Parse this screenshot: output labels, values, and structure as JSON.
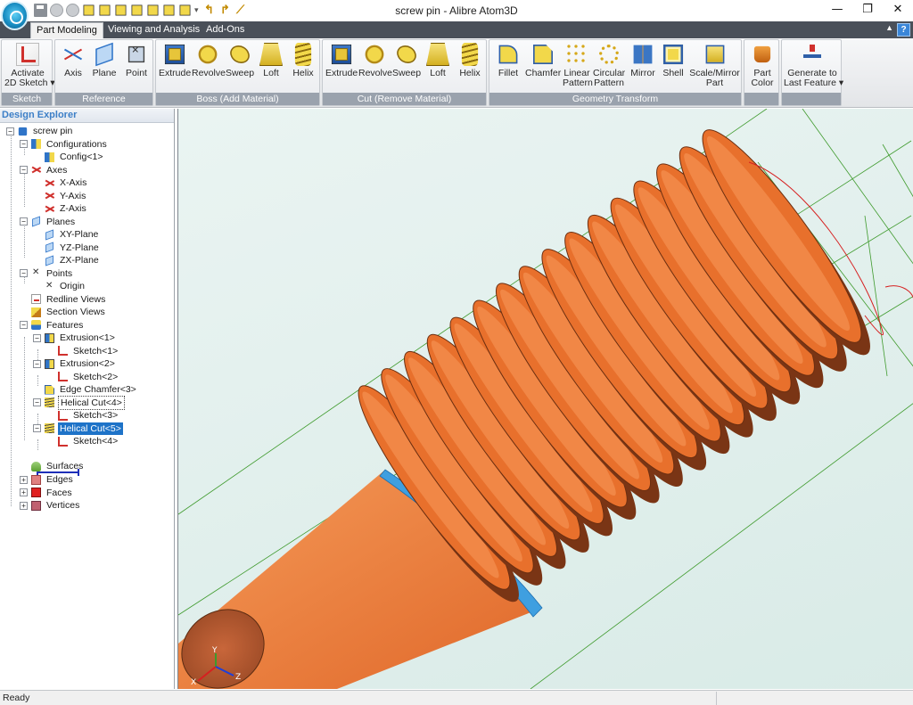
{
  "window": {
    "title": "screw pin - Alibre Atom3D",
    "controls": {
      "minimize": "—",
      "restore": "❐",
      "close": "✕"
    }
  },
  "quick_access": {
    "icons": [
      "save-icon",
      "undo-history-icon",
      "redo-history-icon",
      "view-cube-icon",
      "view-cube-icon",
      "view-cube-icon",
      "view-cube-icon",
      "view-cube-icon",
      "view-cube-icon",
      "view-cube-icon",
      "dropdown-icon",
      "undo-arrow-icon",
      "redo-arrow-icon",
      "sketch-line-icon"
    ]
  },
  "tabs": [
    {
      "label": "Part Modeling",
      "active": true
    },
    {
      "label": "Viewing and Analysis",
      "active": false
    },
    {
      "label": "Add-Ons",
      "active": false
    }
  ],
  "ribbon": {
    "help": "?",
    "groups": {
      "sketch": {
        "label": "Sketch",
        "buttons": [
          {
            "line1": "Activate",
            "line2": "2D Sketch ▾",
            "icon": "sketch-icon"
          }
        ]
      },
      "reference": {
        "label": "Reference",
        "buttons": [
          {
            "line1": "Axis",
            "icon": "axis-icon"
          },
          {
            "line1": "Plane",
            "icon": "plane-icon"
          },
          {
            "line1": "Point",
            "icon": "point-icon"
          }
        ]
      },
      "boss": {
        "label": "Boss (Add Material)",
        "buttons": [
          {
            "line1": "Extrude",
            "icon": "extrude-icon"
          },
          {
            "line1": "Revolve",
            "icon": "revolve-icon"
          },
          {
            "line1": "Sweep",
            "icon": "sweep-icon"
          },
          {
            "line1": "Loft",
            "icon": "loft-icon"
          },
          {
            "line1": "Helix",
            "icon": "helix-icon"
          }
        ]
      },
      "cut": {
        "label": "Cut (Remove Material)",
        "buttons": [
          {
            "line1": "Extrude",
            "icon": "extrude-cut-icon"
          },
          {
            "line1": "Revolve",
            "icon": "revolve-cut-icon"
          },
          {
            "line1": "Sweep",
            "icon": "sweep-cut-icon"
          },
          {
            "line1": "Loft",
            "icon": "loft-cut-icon"
          },
          {
            "line1": "Helix",
            "icon": "helix-cut-icon"
          }
        ]
      },
      "transform": {
        "label": "Geometry Transform",
        "buttons": [
          {
            "line1": "Fillet",
            "icon": "fillet-icon"
          },
          {
            "line1": "Chamfer",
            "icon": "chamfer-icon"
          },
          {
            "line1": "Linear",
            "line2": "Pattern",
            "icon": "linear-pattern-icon"
          },
          {
            "line1": "Circular",
            "line2": "Pattern",
            "icon": "circular-pattern-icon"
          },
          {
            "line1": "Mirror",
            "icon": "mirror-icon"
          },
          {
            "line1": "Shell",
            "icon": "shell-icon"
          },
          {
            "line1": "Scale/Mirror",
            "line2": "Part",
            "icon": "scale-mirror-icon"
          }
        ]
      },
      "color": {
        "buttons": [
          {
            "line1": "Part",
            "line2": "Color",
            "icon": "part-color-icon"
          }
        ]
      },
      "generate": {
        "buttons": [
          {
            "line1": "Generate to",
            "line2": "Last Feature ▾",
            "icon": "generate-icon"
          }
        ]
      }
    }
  },
  "explorer": {
    "title": "Design Explorer",
    "tree": [
      {
        "label": "screw pin",
        "icon": "part-icon",
        "expander": "−"
      },
      {
        "label": "Configurations",
        "icon": "configurations-icon",
        "expander": "−"
      },
      {
        "label": "Config<1>",
        "icon": "config-icon"
      },
      {
        "label": "Axes",
        "icon": "axes-icon",
        "expander": "−"
      },
      {
        "label": "X-Axis",
        "icon": "axis-icon"
      },
      {
        "label": "Y-Axis",
        "icon": "axis-icon"
      },
      {
        "label": "Z-Axis",
        "icon": "axis-icon"
      },
      {
        "label": "Planes",
        "icon": "planes-icon",
        "expander": "−"
      },
      {
        "label": "XY-Plane",
        "icon": "plane-icon"
      },
      {
        "label": "YZ-Plane",
        "icon": "plane-icon"
      },
      {
        "label": "ZX-Plane",
        "icon": "plane-icon"
      },
      {
        "label": "Points",
        "icon": "points-icon",
        "expander": "−"
      },
      {
        "label": "Origin",
        "icon": "point-icon"
      },
      {
        "label": "Redline Views",
        "icon": "redline-icon"
      },
      {
        "label": "Section Views",
        "icon": "section-icon"
      },
      {
        "label": "Features",
        "icon": "features-icon",
        "expander": "−"
      },
      {
        "label": "Extrusion<1>",
        "icon": "extrusion-icon",
        "expander": "−"
      },
      {
        "label": "Sketch<1>",
        "icon": "sketch-icon"
      },
      {
        "label": "Extrusion<2>",
        "icon": "extrusion-icon",
        "expander": "−"
      },
      {
        "label": "Sketch<2>",
        "icon": "sketch-icon"
      },
      {
        "label": "Edge Chamfer<3>",
        "icon": "chamfer-icon"
      },
      {
        "label": "Helical Cut<4>",
        "icon": "helical-cut-icon",
        "expander": "−"
      },
      {
        "label": "Sketch<3>",
        "icon": "sketch-icon"
      },
      {
        "label": "Helical Cut<5>",
        "icon": "helical-cut-icon",
        "expander": "−"
      },
      {
        "label": "Sketch<4>",
        "icon": "sketch-icon"
      },
      {
        "label": "Surfaces",
        "icon": "surfaces-icon"
      },
      {
        "label": "Edges",
        "icon": "edges-icon",
        "expander": "+"
      },
      {
        "label": "Faces",
        "icon": "faces-icon",
        "expander": "+"
      },
      {
        "label": "Vertices",
        "icon": "vertices-icon",
        "expander": "+"
      }
    ]
  },
  "viewport": {
    "model_color": "#f07a32",
    "thread_color": "#e8702c",
    "chamfer_color": "#3f9fe0",
    "bbox_line_color": "#3e9a2c",
    "highlight_color": "#d62020",
    "triad_labels": {
      "x": "X",
      "y": "Y",
      "z": "Z"
    }
  },
  "status": {
    "text": "Ready"
  }
}
